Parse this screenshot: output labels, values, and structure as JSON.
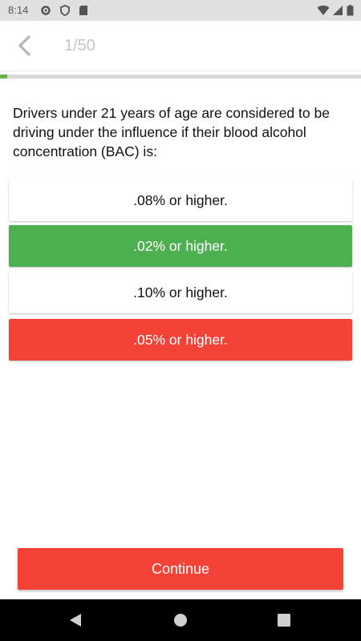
{
  "status_bar": {
    "time": "8:14",
    "icons": [
      "gear-icon",
      "shield-icon",
      "sd-card-icon",
      "wifi-icon",
      "signal-icon",
      "battery-icon"
    ]
  },
  "toolbar": {
    "counter": "1/50",
    "back_icon": "chevron-left-icon"
  },
  "progress": {
    "current": 1,
    "total": 50,
    "fraction": 0.02,
    "color": "#6ab04c"
  },
  "question": {
    "text": "Drivers under 21 years of age are considered to be driving under the influence if their blood alcohol concentration (BAC) is:"
  },
  "answers": [
    {
      "label": ".08% or higher.",
      "state": "default"
    },
    {
      "label": ".02% or higher.",
      "state": "correct"
    },
    {
      "label": ".10% or higher.",
      "state": "default"
    },
    {
      "label": ".05% or higher.",
      "state": "wrong"
    }
  ],
  "continue_button": {
    "label": "Continue"
  },
  "colors": {
    "correct": "#4caf50",
    "wrong": "#f44336",
    "progress": "#6ab04c"
  },
  "nav_bar": {
    "icons": [
      "back-triangle-icon",
      "home-circle-icon",
      "recents-square-icon"
    ]
  }
}
